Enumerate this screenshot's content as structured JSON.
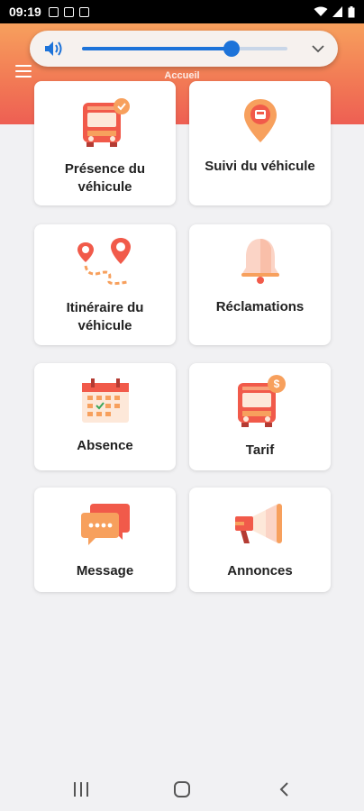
{
  "status_bar": {
    "time": "09:19"
  },
  "header": {
    "title": "Accueil"
  },
  "volume": {
    "level_percent": 73
  },
  "tiles": [
    {
      "label": "Présence du véhicule",
      "icon": "bus-check-icon"
    },
    {
      "label": "Suivi du véhicule",
      "icon": "location-pin-icon"
    },
    {
      "label": "Itinéraire du véhicule",
      "icon": "route-icon"
    },
    {
      "label": "Réclamations",
      "icon": "bell-icon"
    },
    {
      "label": "Absence",
      "icon": "calendar-icon"
    },
    {
      "label": "Tarif",
      "icon": "bus-dollar-icon"
    },
    {
      "label": "Message",
      "icon": "chat-bubbles-icon"
    },
    {
      "label": "Annonces",
      "icon": "megaphone-icon"
    }
  ],
  "colors": {
    "accent": "#f15a4a",
    "orange": "#f7a05d",
    "slider": "#1d73d9"
  }
}
